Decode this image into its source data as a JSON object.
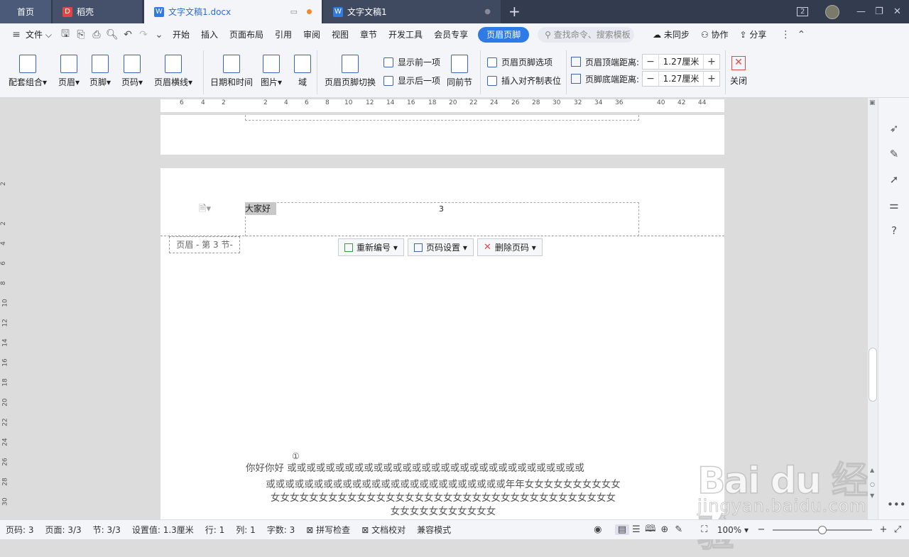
{
  "tabs": {
    "home": "首页",
    "daoke": "稻壳",
    "doc1": "文字文稿1.docx",
    "doc2": "文字文稿1"
  },
  "window": {
    "count": "2"
  },
  "menubar": {
    "file": "文件",
    "items": [
      "开始",
      "插入",
      "页面布局",
      "引用",
      "审阅",
      "视图",
      "章节",
      "开发工具",
      "会员专享",
      "页眉页脚"
    ],
    "search_placeholder": "查找命令、搜索模板",
    "sync": "未同步",
    "collab": "协作",
    "share": "分享"
  },
  "ribbon": {
    "combo": "配套组合",
    "header": "页眉",
    "footer": "页脚",
    "pagenum": "页码",
    "header_line": "页眉横线",
    "datetime": "日期和时间",
    "image": "图片",
    "field": "域",
    "switch": "页眉页脚切换",
    "show_prev": "显示前一项",
    "show_next": "显示后一项",
    "same_prev": "同前节",
    "options": "页眉页脚选项",
    "align_tab": "插入对齐制表位",
    "header_top_label": "页眉顶端距离:",
    "header_top_value": "1.27厘米",
    "footer_bottom_label": "页脚底端距离:",
    "footer_bottom_value": "1.27厘米",
    "close": "关闭"
  },
  "ruler": {
    "ticks": [
      "6",
      "4",
      "2",
      "2",
      "4",
      "6",
      "8",
      "10",
      "12",
      "14",
      "16",
      "18",
      "20",
      "22",
      "24",
      "26",
      "28",
      "30",
      "32",
      "34",
      "36",
      "40",
      "42",
      "44"
    ],
    "vticks": [
      "2",
      "2",
      "4",
      "6",
      "8",
      "10",
      "12",
      "14",
      "16",
      "18",
      "20",
      "22",
      "24",
      "26",
      "28",
      "30"
    ]
  },
  "document": {
    "header_text": "大家好",
    "page_number": "3",
    "header_label": "页眉 - 第 3 节-",
    "renumber": "重新编号",
    "page_settings": "页码设置",
    "delete_pagenum": "删除页码",
    "circle_mark": "①",
    "body_line1": "你好你好    或或或或或或或或或或或或或或或或或或或或或或或或或或或或或或或",
    "body_line2": "或或或或或或或或或或或或或或或或或或或或或或或或或年年女女女女女女女女女女",
    "body_line3": "女女女女女女女女女女女女女女女女女女女女女女女女女女女女女女女女女女女女",
    "body_line4": "女女女女女女女女女女女"
  },
  "statusbar": {
    "pagenum": "页码: 3",
    "page": "页面: 3/3",
    "section": "节: 3/3",
    "setting": "设置值: 1.3厘米",
    "row": "行: 1",
    "col": "列: 1",
    "wordcount": "字数: 3",
    "spellcheck": "拼写检查",
    "proofread": "文档校对",
    "compat": "兼容模式",
    "zoom": "100%",
    "zoom_level": 0.5
  },
  "watermark": {
    "line1": "Bai du 经验",
    "line2": "jingyan.baidu.com"
  }
}
